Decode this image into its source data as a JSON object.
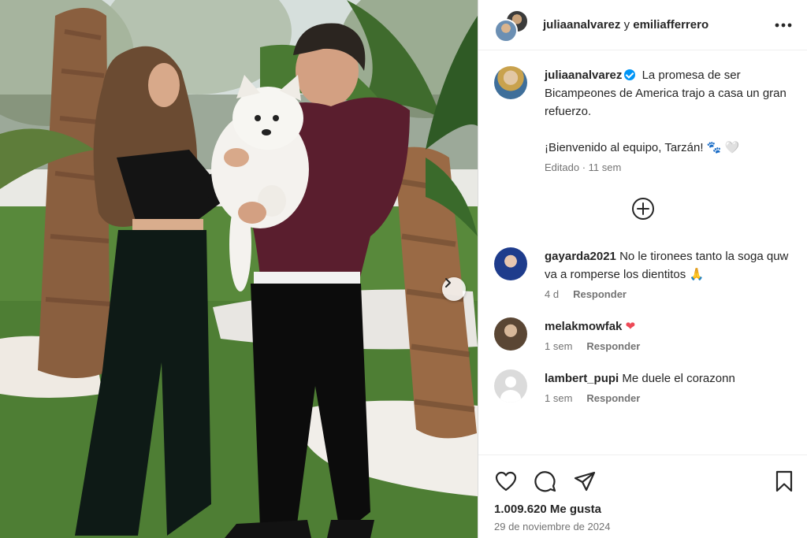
{
  "post": {
    "header_user1": "julia​analvarez",
    "header_join": "y",
    "header_user2": "emiliafferrero",
    "caption_user": "juliaanalvarez",
    "caption_line": "La promesa de ser Bicampeones de America trajo a casa un gran refuerzo.",
    "caption_line2": "¡Bienvenido al equipo, Tarzán!",
    "caption_emoji": "🐾 🤍",
    "caption_meta": "Editado · 11 sem",
    "likes": "1.009.620 Me gusta",
    "date": "29 de noviembre de 2024"
  },
  "comments": [
    {
      "user": "gayarda2021",
      "text": "No le tironees tanto la soga quw va a romperse los dientitos",
      "emoji": "🙏",
      "time": "4 d",
      "reply": "Responder"
    },
    {
      "user": "melakmowfak",
      "text": "",
      "emoji": "❤",
      "time": "1 sem",
      "reply": "Responder"
    },
    {
      "user": "lambert_pupi",
      "text": "Me duele el corazonn",
      "emoji": "",
      "time": "1 sem",
      "reply": "Responder"
    }
  ],
  "icons": {
    "more": "more-options-icon",
    "next": "chevron-right-icon",
    "load_more": "plus-circle-icon",
    "like": "heart-icon",
    "comment": "comment-bubble-icon",
    "share": "share-send-icon",
    "save": "bookmark-icon"
  },
  "colors": {
    "verified": "#0095f6",
    "heart": "#ed4956",
    "muted": "#737373",
    "text": "#262626"
  }
}
